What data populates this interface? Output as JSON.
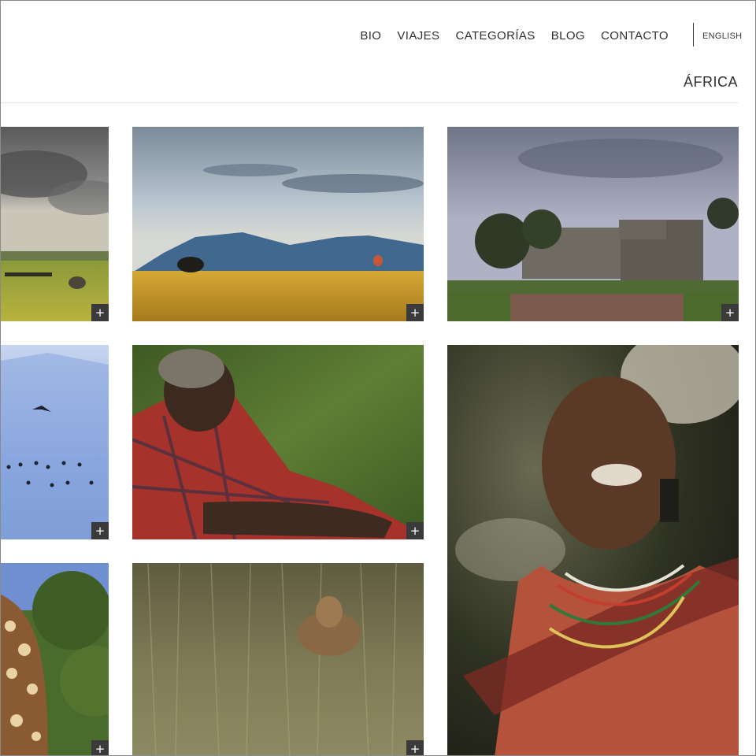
{
  "nav": {
    "items": [
      "BIO",
      "VIAJES",
      "CATEGORÍAS",
      "BLOG",
      "CONTACTO"
    ]
  },
  "language_link": "ENGLISH",
  "page_title": "ÁFRICA",
  "gallery": {
    "expand_label": "+",
    "photos": [
      {
        "name": "storm-savanna-photo",
        "subject": "storm clouds over savanna with elephant"
      },
      {
        "name": "elephant-balloon-photo",
        "subject": "elephant and hot-air balloon on golden plain"
      },
      {
        "name": "wooden-lodge-photo",
        "subject": "wooden lodge under cloudy sky"
      },
      {
        "name": "flamingos-lake-photo",
        "subject": "flamingos on blue lake"
      },
      {
        "name": "maasai-elder-photo",
        "subject": "maasai elder in red plaid shuka"
      },
      {
        "name": "smiling-woman-photo",
        "subject": "smiling maasai woman with beaded necklaces"
      },
      {
        "name": "giraffe-trees-photo",
        "subject": "giraffe among trees"
      },
      {
        "name": "lioness-grass-photo",
        "subject": "lioness in tall grass"
      }
    ]
  },
  "colors": {
    "text": "#2f2f2f",
    "button_bg": "#3a3a3a",
    "divider": "#e6e6e6"
  }
}
